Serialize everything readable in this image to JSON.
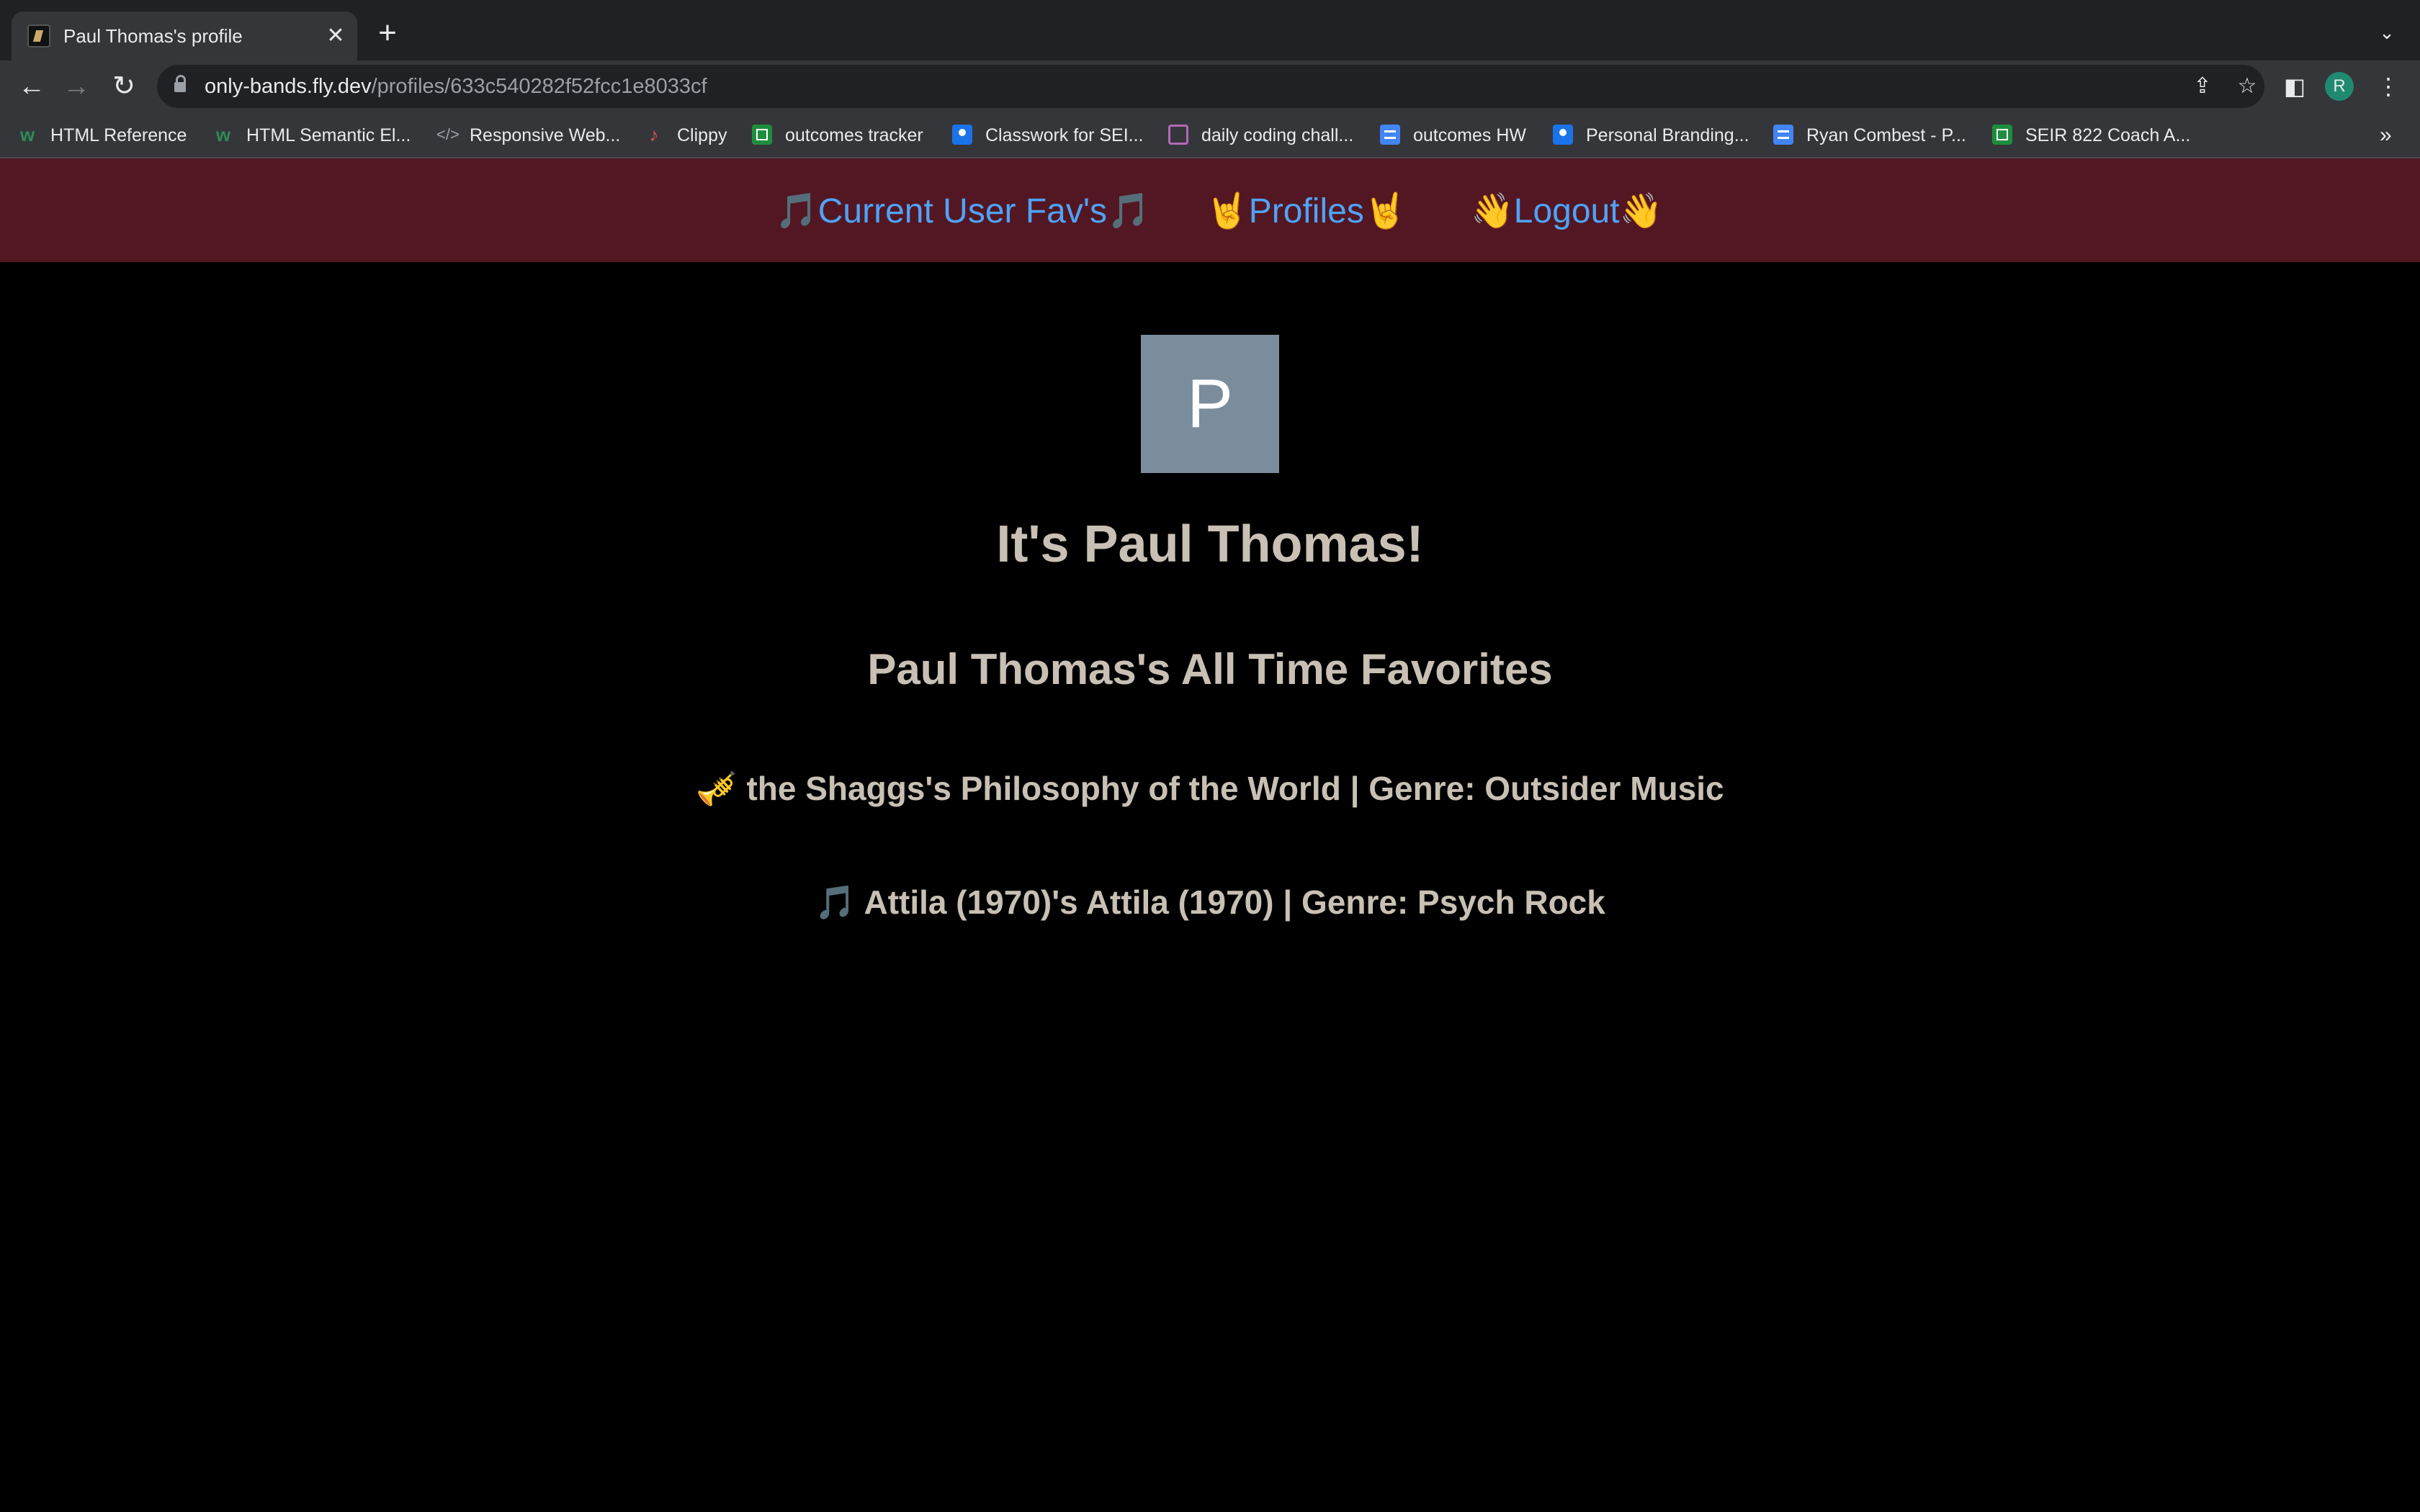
{
  "browser": {
    "tab": {
      "title": "Paul Thomas's profile"
    },
    "url": {
      "host": "only-bands.fly.dev",
      "path": "/profiles/633c540282f52fcc1e8033cf"
    },
    "profile_initial": "R",
    "bookmarks": [
      {
        "label": "HTML Reference",
        "icon": "w3schools-icon"
      },
      {
        "label": "HTML Semantic El...",
        "icon": "w3schools-icon"
      },
      {
        "label": "Responsive Web...",
        "icon": "code-icon"
      },
      {
        "label": "Clippy",
        "icon": "music-note-icon"
      },
      {
        "label": "outcomes tracker",
        "icon": "sheets-icon"
      },
      {
        "label": "Classwork for SEI...",
        "icon": "classroom-icon"
      },
      {
        "label": "daily coding chall...",
        "icon": "star-circle-icon"
      },
      {
        "label": "outcomes HW",
        "icon": "docs-icon"
      },
      {
        "label": "Personal Branding...",
        "icon": "classroom-icon"
      },
      {
        "label": "Ryan Combest - P...",
        "icon": "docs-icon"
      },
      {
        "label": "SEIR 822 Coach A...",
        "icon": "sheets-icon"
      }
    ]
  },
  "site_nav": {
    "favs": "🎵Current User Fav's🎵",
    "profiles": "🤘Profiles🤘",
    "logout": "👋Logout👋"
  },
  "profile": {
    "avatar_letter": "P",
    "heading": "It's Paul Thomas!",
    "favorites_heading": "Paul Thomas's All Time Favorites",
    "favorites": [
      "🎺 the Shaggs's Philosophy of the World | Genre: Outsider Music",
      "🎵 Attila (1970)'s Attila (1970) | Genre: Psych Rock"
    ]
  },
  "colors": {
    "nav_bg": "#521722",
    "link": "#4fa3f7",
    "text": "#c8c0b4",
    "avatar_bg": "#7b8d9c"
  }
}
